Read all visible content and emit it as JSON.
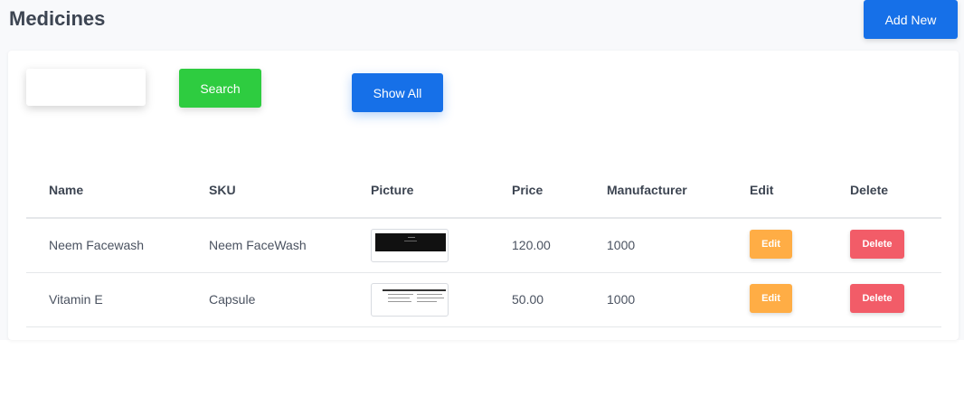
{
  "header": {
    "title": "Medicines",
    "add_new_label": "Add New"
  },
  "search": {
    "value": "",
    "placeholder": "",
    "search_label": "Search",
    "show_all_label": "Show All"
  },
  "table": {
    "columns": [
      "Name",
      "SKU",
      "Picture",
      "Price",
      "Manufacturer",
      "Edit",
      "Delete"
    ],
    "rows": [
      {
        "name": "Neem Facewash",
        "sku": "Neem FaceWash",
        "price": "120.00",
        "manufacturer": "1000",
        "edit_label": "Edit",
        "delete_label": "Delete"
      },
      {
        "name": "Vitamin E",
        "sku": "Capsule",
        "price": "50.00",
        "manufacturer": "1000",
        "edit_label": "Edit",
        "delete_label": "Delete"
      }
    ]
  },
  "colors": {
    "primary": "#1670e8",
    "success": "#2ecc40",
    "warning": "#ffad45",
    "danger": "#f25c68"
  }
}
